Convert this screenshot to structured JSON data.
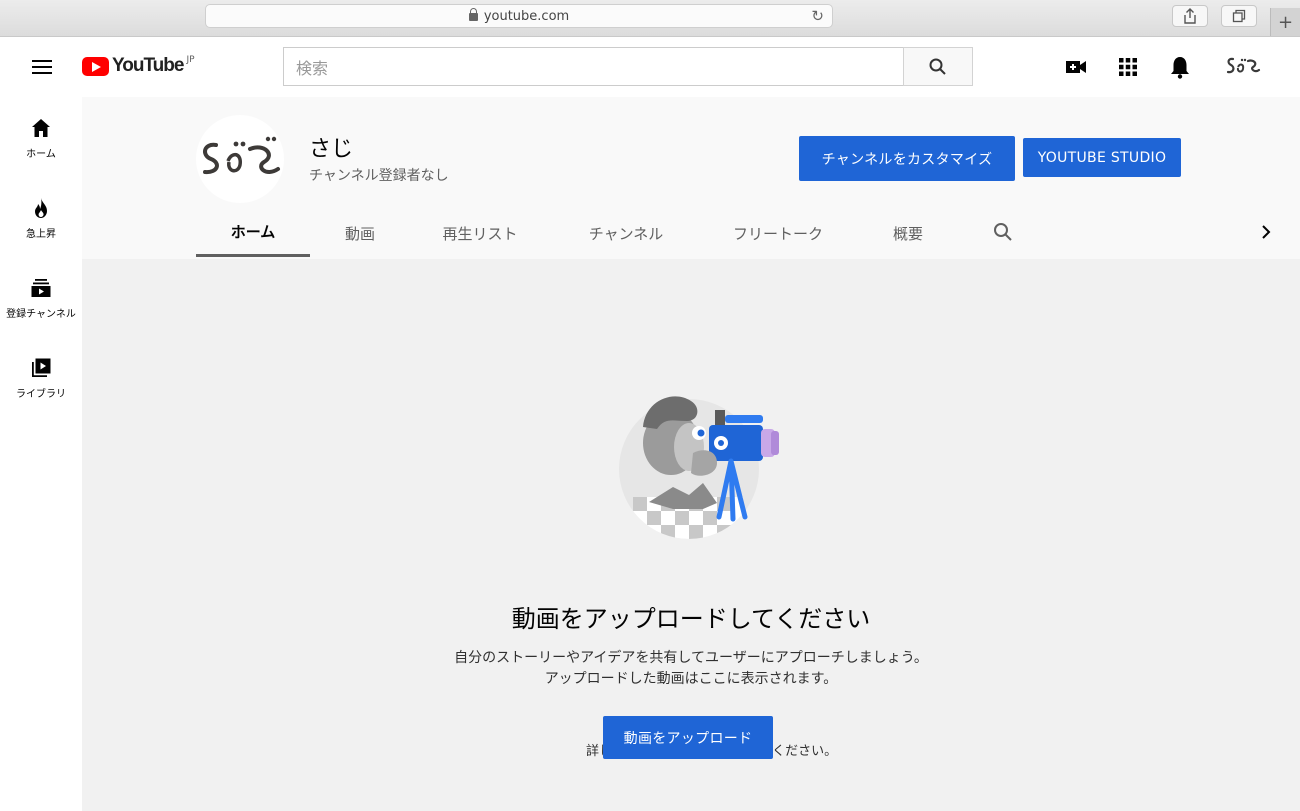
{
  "browser": {
    "url": "youtube.com"
  },
  "masthead": {
    "logo_text": "YouTube",
    "logo_region": "JP",
    "search_placeholder": "検索"
  },
  "guide": {
    "items": [
      {
        "label": "ホーム",
        "icon": "home-icon"
      },
      {
        "label": "急上昇",
        "icon": "flame-icon"
      },
      {
        "label": "登録チャンネル",
        "icon": "subscriptions-icon"
      },
      {
        "label": "ライブラリ",
        "icon": "library-icon"
      }
    ]
  },
  "channel": {
    "name": "さじ",
    "subscribers": "チャンネル登録者なし",
    "customize_label": "チャンネルをカスタマイズ",
    "studio_label": "YOUTUBE STUDIO"
  },
  "tabs": [
    {
      "label": "ホーム",
      "active": true
    },
    {
      "label": "動画"
    },
    {
      "label": "再生リスト"
    },
    {
      "label": "チャンネル"
    },
    {
      "label": "フリートーク"
    },
    {
      "label": "概要"
    }
  ],
  "empty_state": {
    "title": "動画をアップロードしてください",
    "desc_line1": "自分のストーリーやアイデアを共有してユーザーにアプローチしましょう。",
    "desc_line2": "アップロードした動画はここに表示されます。",
    "upload_label": "動画をアップロード",
    "learn_more": "詳しくは ヘルプセンターをご覧ください。"
  },
  "colors": {
    "accent": "#1f65d6",
    "logo_red": "#ff0000"
  }
}
